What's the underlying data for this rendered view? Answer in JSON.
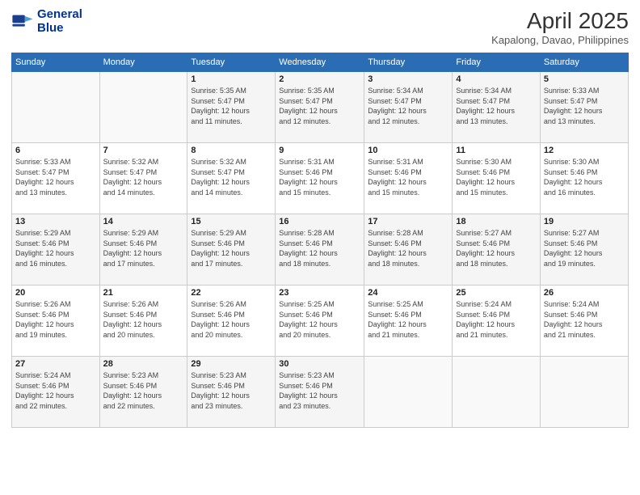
{
  "logo": {
    "line1": "General",
    "line2": "Blue"
  },
  "title": "April 2025",
  "location": "Kapalong, Davao, Philippines",
  "days_header": [
    "Sunday",
    "Monday",
    "Tuesday",
    "Wednesday",
    "Thursday",
    "Friday",
    "Saturday"
  ],
  "weeks": [
    [
      {
        "day": "",
        "info": ""
      },
      {
        "day": "",
        "info": ""
      },
      {
        "day": "1",
        "info": "Sunrise: 5:35 AM\nSunset: 5:47 PM\nDaylight: 12 hours\nand 11 minutes."
      },
      {
        "day": "2",
        "info": "Sunrise: 5:35 AM\nSunset: 5:47 PM\nDaylight: 12 hours\nand 12 minutes."
      },
      {
        "day": "3",
        "info": "Sunrise: 5:34 AM\nSunset: 5:47 PM\nDaylight: 12 hours\nand 12 minutes."
      },
      {
        "day": "4",
        "info": "Sunrise: 5:34 AM\nSunset: 5:47 PM\nDaylight: 12 hours\nand 13 minutes."
      },
      {
        "day": "5",
        "info": "Sunrise: 5:33 AM\nSunset: 5:47 PM\nDaylight: 12 hours\nand 13 minutes."
      }
    ],
    [
      {
        "day": "6",
        "info": "Sunrise: 5:33 AM\nSunset: 5:47 PM\nDaylight: 12 hours\nand 13 minutes."
      },
      {
        "day": "7",
        "info": "Sunrise: 5:32 AM\nSunset: 5:47 PM\nDaylight: 12 hours\nand 14 minutes."
      },
      {
        "day": "8",
        "info": "Sunrise: 5:32 AM\nSunset: 5:47 PM\nDaylight: 12 hours\nand 14 minutes."
      },
      {
        "day": "9",
        "info": "Sunrise: 5:31 AM\nSunset: 5:46 PM\nDaylight: 12 hours\nand 15 minutes."
      },
      {
        "day": "10",
        "info": "Sunrise: 5:31 AM\nSunset: 5:46 PM\nDaylight: 12 hours\nand 15 minutes."
      },
      {
        "day": "11",
        "info": "Sunrise: 5:30 AM\nSunset: 5:46 PM\nDaylight: 12 hours\nand 15 minutes."
      },
      {
        "day": "12",
        "info": "Sunrise: 5:30 AM\nSunset: 5:46 PM\nDaylight: 12 hours\nand 16 minutes."
      }
    ],
    [
      {
        "day": "13",
        "info": "Sunrise: 5:29 AM\nSunset: 5:46 PM\nDaylight: 12 hours\nand 16 minutes."
      },
      {
        "day": "14",
        "info": "Sunrise: 5:29 AM\nSunset: 5:46 PM\nDaylight: 12 hours\nand 17 minutes."
      },
      {
        "day": "15",
        "info": "Sunrise: 5:29 AM\nSunset: 5:46 PM\nDaylight: 12 hours\nand 17 minutes."
      },
      {
        "day": "16",
        "info": "Sunrise: 5:28 AM\nSunset: 5:46 PM\nDaylight: 12 hours\nand 18 minutes."
      },
      {
        "day": "17",
        "info": "Sunrise: 5:28 AM\nSunset: 5:46 PM\nDaylight: 12 hours\nand 18 minutes."
      },
      {
        "day": "18",
        "info": "Sunrise: 5:27 AM\nSunset: 5:46 PM\nDaylight: 12 hours\nand 18 minutes."
      },
      {
        "day": "19",
        "info": "Sunrise: 5:27 AM\nSunset: 5:46 PM\nDaylight: 12 hours\nand 19 minutes."
      }
    ],
    [
      {
        "day": "20",
        "info": "Sunrise: 5:26 AM\nSunset: 5:46 PM\nDaylight: 12 hours\nand 19 minutes."
      },
      {
        "day": "21",
        "info": "Sunrise: 5:26 AM\nSunset: 5:46 PM\nDaylight: 12 hours\nand 20 minutes."
      },
      {
        "day": "22",
        "info": "Sunrise: 5:26 AM\nSunset: 5:46 PM\nDaylight: 12 hours\nand 20 minutes."
      },
      {
        "day": "23",
        "info": "Sunrise: 5:25 AM\nSunset: 5:46 PM\nDaylight: 12 hours\nand 20 minutes."
      },
      {
        "day": "24",
        "info": "Sunrise: 5:25 AM\nSunset: 5:46 PM\nDaylight: 12 hours\nand 21 minutes."
      },
      {
        "day": "25",
        "info": "Sunrise: 5:24 AM\nSunset: 5:46 PM\nDaylight: 12 hours\nand 21 minutes."
      },
      {
        "day": "26",
        "info": "Sunrise: 5:24 AM\nSunset: 5:46 PM\nDaylight: 12 hours\nand 21 minutes."
      }
    ],
    [
      {
        "day": "27",
        "info": "Sunrise: 5:24 AM\nSunset: 5:46 PM\nDaylight: 12 hours\nand 22 minutes."
      },
      {
        "day": "28",
        "info": "Sunrise: 5:23 AM\nSunset: 5:46 PM\nDaylight: 12 hours\nand 22 minutes."
      },
      {
        "day": "29",
        "info": "Sunrise: 5:23 AM\nSunset: 5:46 PM\nDaylight: 12 hours\nand 23 minutes."
      },
      {
        "day": "30",
        "info": "Sunrise: 5:23 AM\nSunset: 5:46 PM\nDaylight: 12 hours\nand 23 minutes."
      },
      {
        "day": "",
        "info": ""
      },
      {
        "day": "",
        "info": ""
      },
      {
        "day": "",
        "info": ""
      }
    ]
  ]
}
